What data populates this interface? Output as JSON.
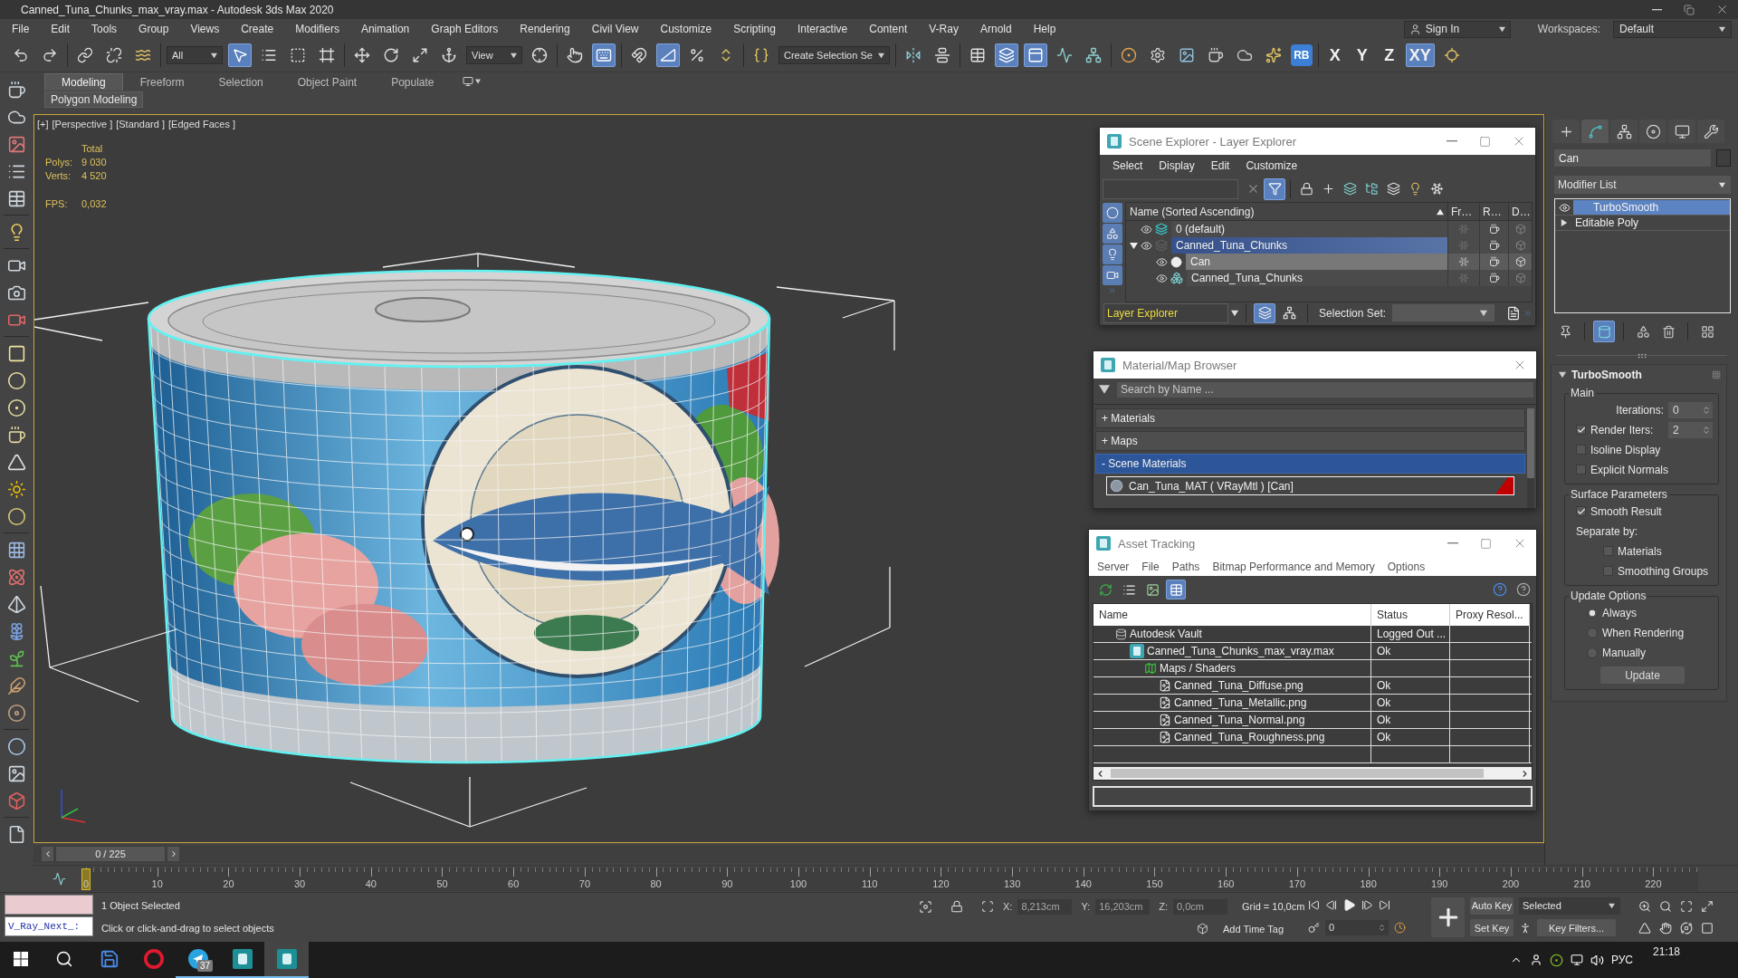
{
  "window": {
    "title": "Canned_Tuna_Chunks_max_vray.max - Autodesk 3ds Max 2020"
  },
  "menu": [
    "File",
    "Edit",
    "Tools",
    "Group",
    "Views",
    "Create",
    "Modifiers",
    "Animation",
    "Graph Editors",
    "Rendering",
    "Civil View",
    "Customize",
    "Scripting",
    "Interactive",
    "Content",
    "V-Ray",
    "Arnold",
    "Help"
  ],
  "account": {
    "sign_in": "Sign In",
    "workspaces_label": "Workspaces:",
    "workspace": "Default"
  },
  "main_toolbar": [
    [
      {
        "kind": "icon",
        "selected": false
      },
      {
        "kind": "icon",
        "selected": false
      }
    ],
    [
      {
        "kind": "icon",
        "selected": false
      },
      {
        "kind": "icon",
        "selected": false
      },
      {
        "kind": "icon",
        "selected": false
      }
    ],
    [
      {
        "kind": "dropdown",
        "value": "All"
      },
      {
        "kind": "icon",
        "selected": true
      },
      {
        "kind": "icon",
        "selected": false
      },
      {
        "kind": "icon",
        "selected": false
      },
      {
        "kind": "icon",
        "selected": false
      }
    ],
    [
      {
        "kind": "icon",
        "selected": false
      },
      {
        "kind": "icon",
        "selected": false
      },
      {
        "kind": "icon",
        "selected": false
      },
      {
        "kind": "icon",
        "selected": false
      },
      {
        "kind": "dropdown",
        "value": "View"
      },
      {
        "kind": "icon",
        "selected": false
      }
    ],
    [
      {
        "kind": "icon",
        "selected": false
      },
      {
        "kind": "icon",
        "selected": true
      }
    ],
    [
      {
        "kind": "icon",
        "selected": false
      },
      {
        "kind": "icon",
        "selected": true
      },
      {
        "kind": "icon",
        "selected": false
      },
      {
        "kind": "icon",
        "selected": false
      }
    ],
    [
      {
        "kind": "icon",
        "selected": false
      },
      {
        "kind": "dropdown",
        "value": "Create Selection Se"
      }
    ],
    [
      {
        "kind": "icon",
        "selected": false
      },
      {
        "kind": "icon",
        "selected": false
      }
    ],
    [
      {
        "kind": "icon",
        "selected": false
      },
      {
        "kind": "icon",
        "selected": true
      },
      {
        "kind": "icon",
        "selected": true
      },
      {
        "kind": "icon",
        "selected": false
      },
      {
        "kind": "icon",
        "selected": false
      }
    ],
    [
      {
        "kind": "icon",
        "selected": false
      },
      {
        "kind": "icon",
        "selected": false
      },
      {
        "kind": "icon",
        "selected": false
      },
      {
        "kind": "icon",
        "selected": false
      },
      {
        "kind": "icon",
        "selected": false
      },
      {
        "kind": "icon",
        "selected": false
      },
      {
        "kind": "badge",
        "label": "RB"
      }
    ],
    [
      {
        "kind": "axis",
        "label": "X",
        "selected": false
      },
      {
        "kind": "axis",
        "label": "Y",
        "selected": false
      },
      {
        "kind": "axis",
        "label": "Z",
        "selected": false
      },
      {
        "kind": "axis",
        "label": "XY",
        "selected": true
      },
      {
        "kind": "icon",
        "selected": false
      }
    ]
  ],
  "ribbon": {
    "tabs": [
      {
        "label": "Modeling",
        "selected": true
      },
      {
        "label": "Freeform",
        "selected": false
      },
      {
        "label": "Selection",
        "selected": false
      },
      {
        "label": "Object Paint",
        "selected": false
      },
      {
        "label": "Populate",
        "selected": false
      }
    ],
    "panel": "Polygon Modeling"
  },
  "viewport": {
    "labels": [
      "[+]",
      "[Perspective ]",
      "[Standard ]",
      "[Edged Faces ]"
    ],
    "stats_header": "Total",
    "stats": [
      {
        "label": "Polys:",
        "value": "9 030"
      },
      {
        "label": "Verts:",
        "value": "4 520"
      }
    ],
    "fps": {
      "label": "FPS:",
      "value": "0,032"
    }
  },
  "scene_explorer": {
    "title": "Scene Explorer - Layer Explorer",
    "menu": [
      "Select",
      "Display",
      "Edit",
      "Customize"
    ],
    "toolbar": [
      {
        "selected": false
      },
      {
        "selected": true
      },
      {
        "selected": false
      },
      {
        "selected": false
      },
      {
        "selected": false
      },
      {
        "selected": false
      },
      {
        "selected": false
      },
      {
        "selected": false
      },
      {
        "selected": false
      }
    ],
    "filters": [
      {
        "selected": true
      },
      {
        "selected": true
      },
      {
        "selected": true
      },
      {
        "selected": true
      }
    ],
    "columns": [
      "Name (Sorted Ascending)",
      "Fr…",
      "R…",
      "D…"
    ],
    "tree": [
      {
        "kind": "layer",
        "name": "0 (default)",
        "active": true,
        "selected": false,
        "highlighted": false
      },
      {
        "kind": "layer",
        "name": "Canned_Tuna_Chunks",
        "active": false,
        "selected": true,
        "highlighted": false,
        "expanded": true,
        "children": [
          {
            "kind": "geometry",
            "name": "Can",
            "selected": false,
            "highlighted": true
          },
          {
            "kind": "group",
            "name": "Canned_Tuna_Chunks",
            "selected": false,
            "highlighted": false
          }
        ]
      }
    ],
    "explorer_mode": "Layer Explorer",
    "view_buttons": [
      {
        "selected": true
      },
      {
        "selected": false
      }
    ],
    "selection_set_label": "Selection Set:"
  },
  "material_browser": {
    "title": "Material/Map Browser",
    "search": {
      "placeholder": "Search by Name ..."
    },
    "groups": [
      {
        "toggle": "+",
        "label": "Materials",
        "expanded": false
      },
      {
        "toggle": "+",
        "label": "Maps",
        "expanded": false
      },
      {
        "toggle": "-",
        "label": "Scene Materials",
        "expanded": true,
        "items": [
          "Can_Tuna_MAT ( VRayMtl ) [Can]"
        ]
      }
    ]
  },
  "asset_tracking": {
    "title": "Asset Tracking",
    "menu": [
      "Server",
      "File",
      "Paths",
      "Bitmap Performance and Memory",
      "Options"
    ],
    "toolbar": [
      {
        "selected": false
      },
      {
        "selected": false
      },
      {
        "selected": false
      },
      {
        "selected": true
      }
    ],
    "columns": [
      "Name",
      "Status",
      "Proxy Resol..."
    ],
    "tree": [
      {
        "kind": "vault",
        "name": "Autodesk Vault",
        "status": "Logged Out ...",
        "children": [
          {
            "kind": "scene",
            "name": "Canned_Tuna_Chunks_max_vray.max",
            "status": "Ok",
            "children": [
              {
                "kind": "folder",
                "name": "Maps / Shaders",
                "children": [
                  {
                    "kind": "bitmap",
                    "name": "Canned_Tuna_Diffuse.png",
                    "status": "Ok"
                  },
                  {
                    "kind": "bitmap",
                    "name": "Canned_Tuna_Metallic.png",
                    "status": "Ok"
                  },
                  {
                    "kind": "bitmap",
                    "name": "Canned_Tuna_Normal.png",
                    "status": "Ok"
                  },
                  {
                    "kind": "bitmap",
                    "name": "Canned_Tuna_Roughness.png",
                    "status": "Ok"
                  }
                ]
              }
            ]
          }
        ]
      }
    ]
  },
  "command_panel": {
    "tabs": [
      {
        "selected": false
      },
      {
        "selected": true
      },
      {
        "selected": false
      },
      {
        "selected": false
      },
      {
        "selected": false
      },
      {
        "selected": false
      }
    ],
    "object_name": "Can",
    "modifier_list": "Modifier List",
    "stack": [
      {
        "kind": "modifier",
        "name": "TurboSmooth",
        "selected": true
      },
      {
        "kind": "base",
        "name": "Editable Poly",
        "selected": false
      }
    ],
    "stack_tools": [
      {
        "selected": false
      },
      {
        "selected": true
      },
      {
        "selected": false
      },
      {
        "selected": false
      },
      {
        "selected": false
      }
    ],
    "rollout": {
      "title": "TurboSmooth",
      "expanded": true,
      "groups": [
        {
          "title": "Main",
          "controls": [
            {
              "kind": "spinner",
              "label": "Iterations:",
              "value": "0"
            },
            {
              "kind": "check-spinner",
              "label": "Render Iters:",
              "value": "2",
              "checked": true
            },
            {
              "kind": "checkbox",
              "label": "Isoline Display",
              "checked": false
            },
            {
              "kind": "checkbox",
              "label": "Explicit Normals",
              "checked": false
            }
          ]
        },
        {
          "title": "Surface Parameters",
          "controls": [
            {
              "kind": "checkbox",
              "label": "Smooth Result",
              "checked": true
            },
            {
              "kind": "heading",
              "label": "Separate by:",
              "children": [
                {
                  "kind": "checkbox",
                  "label": "Materials",
                  "checked": false
                },
                {
                  "kind": "checkbox",
                  "label": "Smoothing Groups",
                  "checked": false
                }
              ]
            }
          ]
        },
        {
          "title": "Update Options",
          "controls": [
            {
              "kind": "radio",
              "label": "Always",
              "selected": true
            },
            {
              "kind": "radio",
              "label": "When Rendering",
              "selected": false
            },
            {
              "kind": "radio",
              "label": "Manually",
              "selected": false
            },
            {
              "kind": "button",
              "label": "Update"
            }
          ]
        }
      ]
    }
  },
  "time_slider": {
    "label": "0 / 225",
    "level": 0
  },
  "track_bar": {
    "ticks": [
      "0",
      "10",
      "20",
      "30",
      "40",
      "50",
      "60",
      "70",
      "80",
      "90",
      "100",
      "110",
      "120",
      "130",
      "140",
      "150",
      "160",
      "170",
      "180",
      "190",
      "200",
      "210",
      "220"
    ]
  },
  "status_bar": {
    "listener_output": "V_Ray_Next_:",
    "selection": "1 Object Selected",
    "prompt": "Click or click-and-drag to select objects",
    "coords": [
      {
        "label": "X:",
        "value": "8,213cm"
      },
      {
        "label": "Y:",
        "value": "16,203cm"
      },
      {
        "label": "Z:",
        "value": "0,0cm"
      }
    ],
    "grid": "Grid = 10,0cm",
    "time_tag": "Add Time Tag",
    "frame": "0",
    "auto_key": "Auto Key",
    "key_set": "Selected",
    "set_key": "Set Key",
    "key_filters": "Key Filters..."
  },
  "taskbar": {
    "apps": [
      {
        "selected": false,
        "running": false
      },
      {
        "selected": false,
        "running": false
      },
      {
        "selected": false,
        "running": true,
        "badge": "37"
      },
      {
        "selected": false,
        "running": true
      },
      {
        "selected": true,
        "running": true
      }
    ],
    "language": "РУС",
    "time": "21:18"
  }
}
